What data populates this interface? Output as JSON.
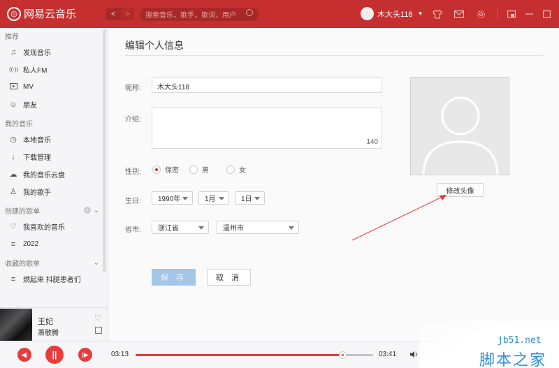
{
  "app": {
    "name": "网易云音乐",
    "logo_glyph": "◎",
    "brand_color": "#c62f2f"
  },
  "titlebar": {
    "back_icon": "chevron-left-icon",
    "forward_icon": "chevron-right-icon",
    "search_placeholder": "搜索音乐，歌手，歌词，用户",
    "username": "木大头118"
  },
  "sidebar": {
    "sections": [
      {
        "title": "推荐",
        "items": [
          {
            "icon": "music-note-icon",
            "glyph": "♫",
            "label": "发现音乐"
          },
          {
            "icon": "radio-icon",
            "glyph": "((·))",
            "label": "私人FM"
          },
          {
            "icon": "video-icon",
            "glyph": "▸",
            "label": "MV"
          },
          {
            "icon": "friends-icon",
            "glyph": "☺",
            "label": "朋友"
          }
        ]
      },
      {
        "title": "我的音乐",
        "items": [
          {
            "icon": "clock-icon",
            "glyph": "◷",
            "label": "本地音乐"
          },
          {
            "icon": "download-icon",
            "glyph": "↓",
            "label": "下载管理"
          },
          {
            "icon": "cloud-icon",
            "glyph": "☁",
            "label": "我的音乐云盘"
          },
          {
            "icon": "singer-icon",
            "glyph": "♙",
            "label": "我的歌手"
          }
        ]
      },
      {
        "title": "创建的歌单",
        "items": [
          {
            "icon": "heart-icon",
            "glyph": "♡",
            "label": "我喜欢的音乐"
          },
          {
            "icon": "playlist-icon",
            "glyph": "≡",
            "label": "2022"
          }
        ]
      },
      {
        "title": "收藏的歌单",
        "items": [
          {
            "icon": "playlist-icon",
            "glyph": "≡",
            "label": "燃起来 抖腿患者们"
          }
        ]
      }
    ]
  },
  "now_playing": {
    "title": "王妃",
    "artist": "萧敬腾"
  },
  "form": {
    "page_title": "编辑个人信息",
    "nickname_label": "昵称:",
    "nickname_value": "木大头118",
    "intro_label": "介绍:",
    "intro_value": "",
    "intro_remaining": "140",
    "gender_label": "性别:",
    "gender_options": [
      "保密",
      "男",
      "女"
    ],
    "gender_selected": "保密",
    "birthday_label": "生日:",
    "birth_year": "1990年",
    "birth_month": "1月",
    "birth_day": "1日",
    "region_label": "省市:",
    "province": "浙江省",
    "city": "温州市",
    "save_label": "保 存",
    "cancel_label": "取 消",
    "change_avatar_label": "修改头像"
  },
  "player": {
    "current_time": "03:13",
    "total_time": "03:41",
    "progress_fraction": 0.873,
    "accent_color": "#e83c3c"
  },
  "watermark": {
    "site": "jb51.net",
    "name": "脚本之家"
  }
}
